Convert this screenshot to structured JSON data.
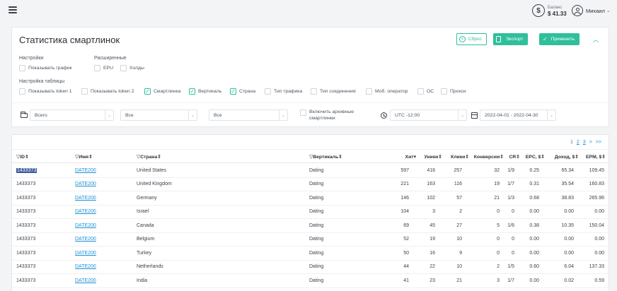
{
  "topbar": {
    "balance_label": "Баланс",
    "balance_value": "$ 41.33",
    "user_name": "Михаил",
    "user_chevron": "⌄"
  },
  "filters": {
    "title": "Статистика смартлинок",
    "buttons": {
      "reset": "Сброс",
      "export": "Экспорт",
      "apply": "Применить"
    },
    "settings_label": "Настройки",
    "extended_label": "Расширенные",
    "table_settings_label": "Настройка таблицы",
    "settings": [
      {
        "label": "Показывать график",
        "checked": false
      }
    ],
    "extended": [
      {
        "label": "EPU",
        "checked": false
      },
      {
        "label": "Холды",
        "checked": false
      }
    ],
    "table_settings": [
      {
        "label": "Показывать token 1",
        "checked": false
      },
      {
        "label": "Показывать token 2",
        "checked": false
      },
      {
        "label": "Смартлинка",
        "checked": true
      },
      {
        "label": "Вертикаль",
        "checked": true
      },
      {
        "label": "Страна",
        "checked": true
      },
      {
        "label": "Тип трафика",
        "checked": false
      },
      {
        "label": "Тип соединения",
        "checked": false
      },
      {
        "label": "Моб. оператор",
        "checked": false
      },
      {
        "label": "ОС",
        "checked": false
      },
      {
        "label": "Прокси",
        "checked": false
      }
    ],
    "select_all_1": "Всего",
    "select_all_2": "Все",
    "select_all_3": "Все",
    "archive_label_1": "Включить архивные",
    "archive_label_2": "смартлинки",
    "timezone": "UTC -12:00",
    "date_range": "2022-04-01 - 2022-04-30"
  },
  "pager": {
    "p1": "1",
    "p2": "2",
    "p3": "3",
    "next": ">",
    "last": ">>"
  },
  "table": {
    "headers": [
      "ID",
      "Имя",
      "Страна",
      "Вертикаль",
      "Хит",
      "Уники",
      "Клики",
      "Конверсии",
      "CR",
      "EPC, $",
      "Доход, $",
      "EPM, $"
    ],
    "sort_glyph": "⇕",
    "sort_desc_glyph": "▾",
    "filter_glyph": "▽",
    "rows": [
      {
        "id": "1433373",
        "name": "DATE200",
        "country": "United States",
        "vertical": "Dating",
        "hits": "597",
        "uniques": "416",
        "clicks": "257",
        "conv": "32",
        "cr": "1/9",
        "epc": "0.25",
        "income": "65.34",
        "epm": "109.45"
      },
      {
        "id": "1433373",
        "name": "DATE200",
        "country": "United Kingdom",
        "vertical": "Dating",
        "hits": "221",
        "uniques": "163",
        "clicks": "116",
        "conv": "19",
        "cr": "1/7",
        "epc": "0.31",
        "income": "35.54",
        "epm": "160.83"
      },
      {
        "id": "1433373",
        "name": "DATE200",
        "country": "Germany",
        "vertical": "Dating",
        "hits": "146",
        "uniques": "102",
        "clicks": "57",
        "conv": "21",
        "cr": "1/3",
        "epc": "0.68",
        "income": "38.83",
        "epm": "265.96"
      },
      {
        "id": "1433373",
        "name": "DATE200",
        "country": "Israel",
        "vertical": "Dating",
        "hits": "104",
        "uniques": "3",
        "clicks": "2",
        "conv": "0",
        "cr": "0",
        "epc": "0.00",
        "income": "0.00",
        "epm": "0.00"
      },
      {
        "id": "1433373",
        "name": "DATE200",
        "country": "Canada",
        "vertical": "Dating",
        "hits": "69",
        "uniques": "45",
        "clicks": "27",
        "conv": "5",
        "cr": "1/6",
        "epc": "0.38",
        "income": "10.35",
        "epm": "150.04"
      },
      {
        "id": "1433373",
        "name": "DATE200",
        "country": "Belgium",
        "vertical": "Dating",
        "hits": "52",
        "uniques": "19",
        "clicks": "10",
        "conv": "0",
        "cr": "0",
        "epc": "0.00",
        "income": "0.00",
        "epm": "0.00"
      },
      {
        "id": "1433373",
        "name": "DATE200",
        "country": "Turkey",
        "vertical": "Dating",
        "hits": "50",
        "uniques": "16",
        "clicks": "9",
        "conv": "0",
        "cr": "0",
        "epc": "0.00",
        "income": "0.00",
        "epm": "0.00"
      },
      {
        "id": "1433373",
        "name": "DATE200",
        "country": "Netherlands",
        "vertical": "Dating",
        "hits": "44",
        "uniques": "22",
        "clicks": "10",
        "conv": "2",
        "cr": "1/5",
        "epc": "0.60",
        "income": "6.04",
        "epm": "137.33"
      },
      {
        "id": "1433373",
        "name": "DATE200",
        "country": "India",
        "vertical": "Dating",
        "hits": "41",
        "uniques": "23",
        "clicks": "21",
        "conv": "3",
        "cr": "1/7",
        "epc": "0.00",
        "income": "0.02",
        "epm": "0.59"
      }
    ]
  },
  "colors": {
    "accent": "#2fbf9b",
    "link": "#1e8fd6",
    "selection": "#3f5b9e"
  }
}
